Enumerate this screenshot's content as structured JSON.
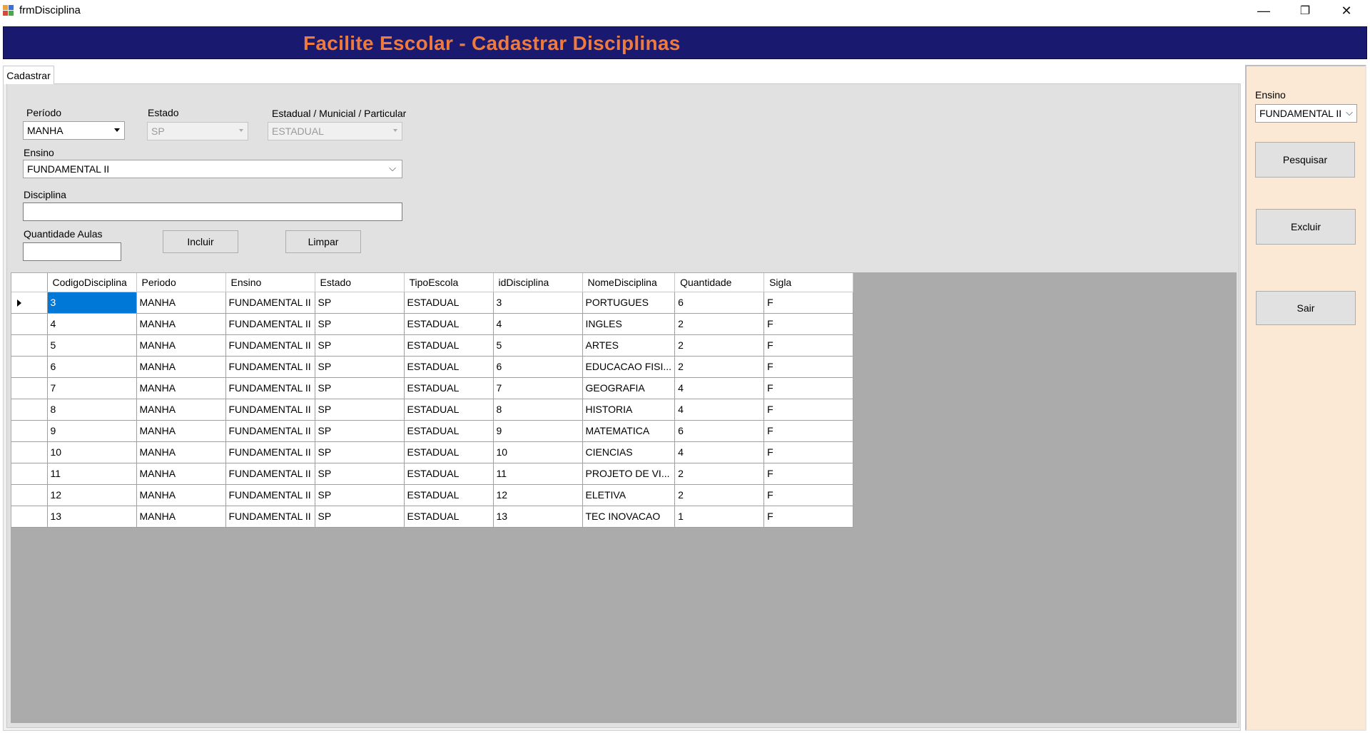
{
  "window": {
    "title": "frmDisciplina",
    "minimize_glyph": "—",
    "maximize_glyph": "❐",
    "close_glyph": "✕"
  },
  "banner": {
    "title": "Facilite Escolar - Cadastrar Disciplinas"
  },
  "tab": {
    "label": "Cadastrar"
  },
  "form": {
    "periodo_label": "Período",
    "periodo_value": "MANHA",
    "estado_label": "Estado",
    "estado_value": "SP",
    "tipo_label": "Estadual / Municial / Particular",
    "tipo_value": "ESTADUAL",
    "ensino_label": "Ensino",
    "ensino_value": "FUNDAMENTAL II",
    "disciplina_label": "Disciplina",
    "disciplina_value": "",
    "quantidade_label": "Quantidade Aulas",
    "quantidade_value": "",
    "incluir_label": "Incluir",
    "limpar_label": "Limpar"
  },
  "grid": {
    "columns": [
      "CodigoDisciplina",
      "Periodo",
      "Ensino",
      "Estado",
      "TipoEscola",
      "idDisciplina",
      "NomeDisciplina",
      "Quantidade",
      "Sigla"
    ],
    "rows": [
      [
        "3",
        "MANHA",
        "FUNDAMENTAL II",
        "SP",
        "ESTADUAL",
        "3",
        "PORTUGUES",
        "6",
        "F"
      ],
      [
        "4",
        "MANHA",
        "FUNDAMENTAL II",
        "SP",
        "ESTADUAL",
        "4",
        "INGLES",
        "2",
        "F"
      ],
      [
        "5",
        "MANHA",
        "FUNDAMENTAL II",
        "SP",
        "ESTADUAL",
        "5",
        "ARTES",
        "2",
        "F"
      ],
      [
        "6",
        "MANHA",
        "FUNDAMENTAL II",
        "SP",
        "ESTADUAL",
        "6",
        "EDUCACAO FISI...",
        "2",
        "F"
      ],
      [
        "7",
        "MANHA",
        "FUNDAMENTAL II",
        "SP",
        "ESTADUAL",
        "7",
        "GEOGRAFIA",
        "4",
        "F"
      ],
      [
        "8",
        "MANHA",
        "FUNDAMENTAL II",
        "SP",
        "ESTADUAL",
        "8",
        "HISTORIA",
        "4",
        "F"
      ],
      [
        "9",
        "MANHA",
        "FUNDAMENTAL II",
        "SP",
        "ESTADUAL",
        "9",
        "MATEMATICA",
        "6",
        "F"
      ],
      [
        "10",
        "MANHA",
        "FUNDAMENTAL II",
        "SP",
        "ESTADUAL",
        "10",
        "CIENCIAS",
        "4",
        "F"
      ],
      [
        "11",
        "MANHA",
        "FUNDAMENTAL II",
        "SP",
        "ESTADUAL",
        "11",
        "PROJETO DE VI...",
        "2",
        "F"
      ],
      [
        "12",
        "MANHA",
        "FUNDAMENTAL II",
        "SP",
        "ESTADUAL",
        "12",
        "ELETIVA",
        "2",
        "F"
      ],
      [
        "13",
        "MANHA",
        "FUNDAMENTAL II",
        "SP",
        "ESTADUAL",
        "13",
        "TEC INOVACAO",
        "1",
        "F"
      ]
    ]
  },
  "side": {
    "ensino_label": "Ensino",
    "ensino_value": "FUNDAMENTAL II",
    "pesquisar_label": "Pesquisar",
    "excluir_label": "Excluir",
    "sair_label": "Sair"
  },
  "colors": {
    "banner_bg": "#191970",
    "banner_text": "#f07a3c",
    "side_panel_bg": "#fbe8d5",
    "grid_bg": "#ababab",
    "selection": "#0078d7"
  }
}
